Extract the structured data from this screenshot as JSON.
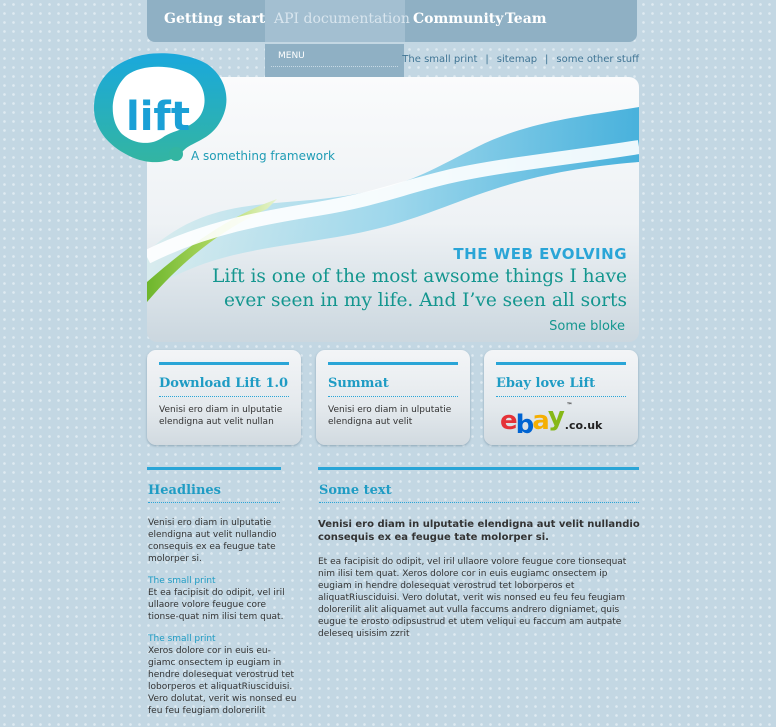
{
  "nav": {
    "items": [
      "Getting started",
      "API documentation",
      "Community",
      "Team"
    ],
    "dropdown_label": "MENU"
  },
  "util_links": [
    "The small print",
    "sitemap",
    "some other stuff"
  ],
  "logo": {
    "wordmark": "lift",
    "tagline": "A something framework"
  },
  "hero": {
    "kicker": "THE WEB EVOLVING",
    "quote": "Lift is one of the most awsome things I have ever seen in my life. And I’ve seen all sorts",
    "author": "Some bloke"
  },
  "boxes": [
    {
      "title": "Download Lift 1.0",
      "text": "Venisi ero diam in ulputatie elendigna aut velit nullan"
    },
    {
      "title": "Summat",
      "text": "Venisi ero diam in ulputatie elendigna aut velit"
    },
    {
      "title": "Ebay love Lift",
      "ebay_letters": [
        "e",
        "b",
        "a",
        "y"
      ],
      "ebay_suffix": ".co.uk",
      "ebay_tm": "™"
    }
  ],
  "headlines": {
    "heading": "Headlines",
    "intro": "Venisi ero diam in ulputatie elendigna aut velit nullandio consequis ex ea feugue tate molorper si.",
    "items": [
      {
        "label": "The small print",
        "text": "Et ea facipisit do odipit, vel iril ullaore volore feugue core tionse-quat nim ilisi tem quat."
      },
      {
        "label": "The small print",
        "text": "Xeros dolore cor in euis eu-giamc onsectem ip eugiam in hendre dolesequat verostrud tet loborperos et aliquatRiusciduisi. Vero dolutat, verit wis nonsed eu feu feu feugiam dolorerilit"
      }
    ]
  },
  "some_text": {
    "heading": "Some text",
    "lead": "Venisi ero diam in ulputatie elendigna aut velit nullandio consequis ex ea feugue tate molorper si.",
    "body": "Et ea facipisit do odipit, vel iril ullaore volore feugue core tionsequat nim ilisi tem quat. Xeros dolore cor in euis eugiamc onsectem ip eugiam in hendre dolesequat verostrud tet loborperos et aliquatRiusciduisi. Vero dolutat, verit wis nonsed eu feu feu feugiam dolorerilit alit aliquamet aut vulla faccums andrero digniamet, quis eugue te erosto odipsustrud et utem veliqui eu faccum am autpate deleseq uisisim zzrit"
  },
  "colors": {
    "accent": "#2aa5d7",
    "teal": "#14968f",
    "nav_bg": "#8fb0c4",
    "page_bg": "#c3d7e3"
  }
}
